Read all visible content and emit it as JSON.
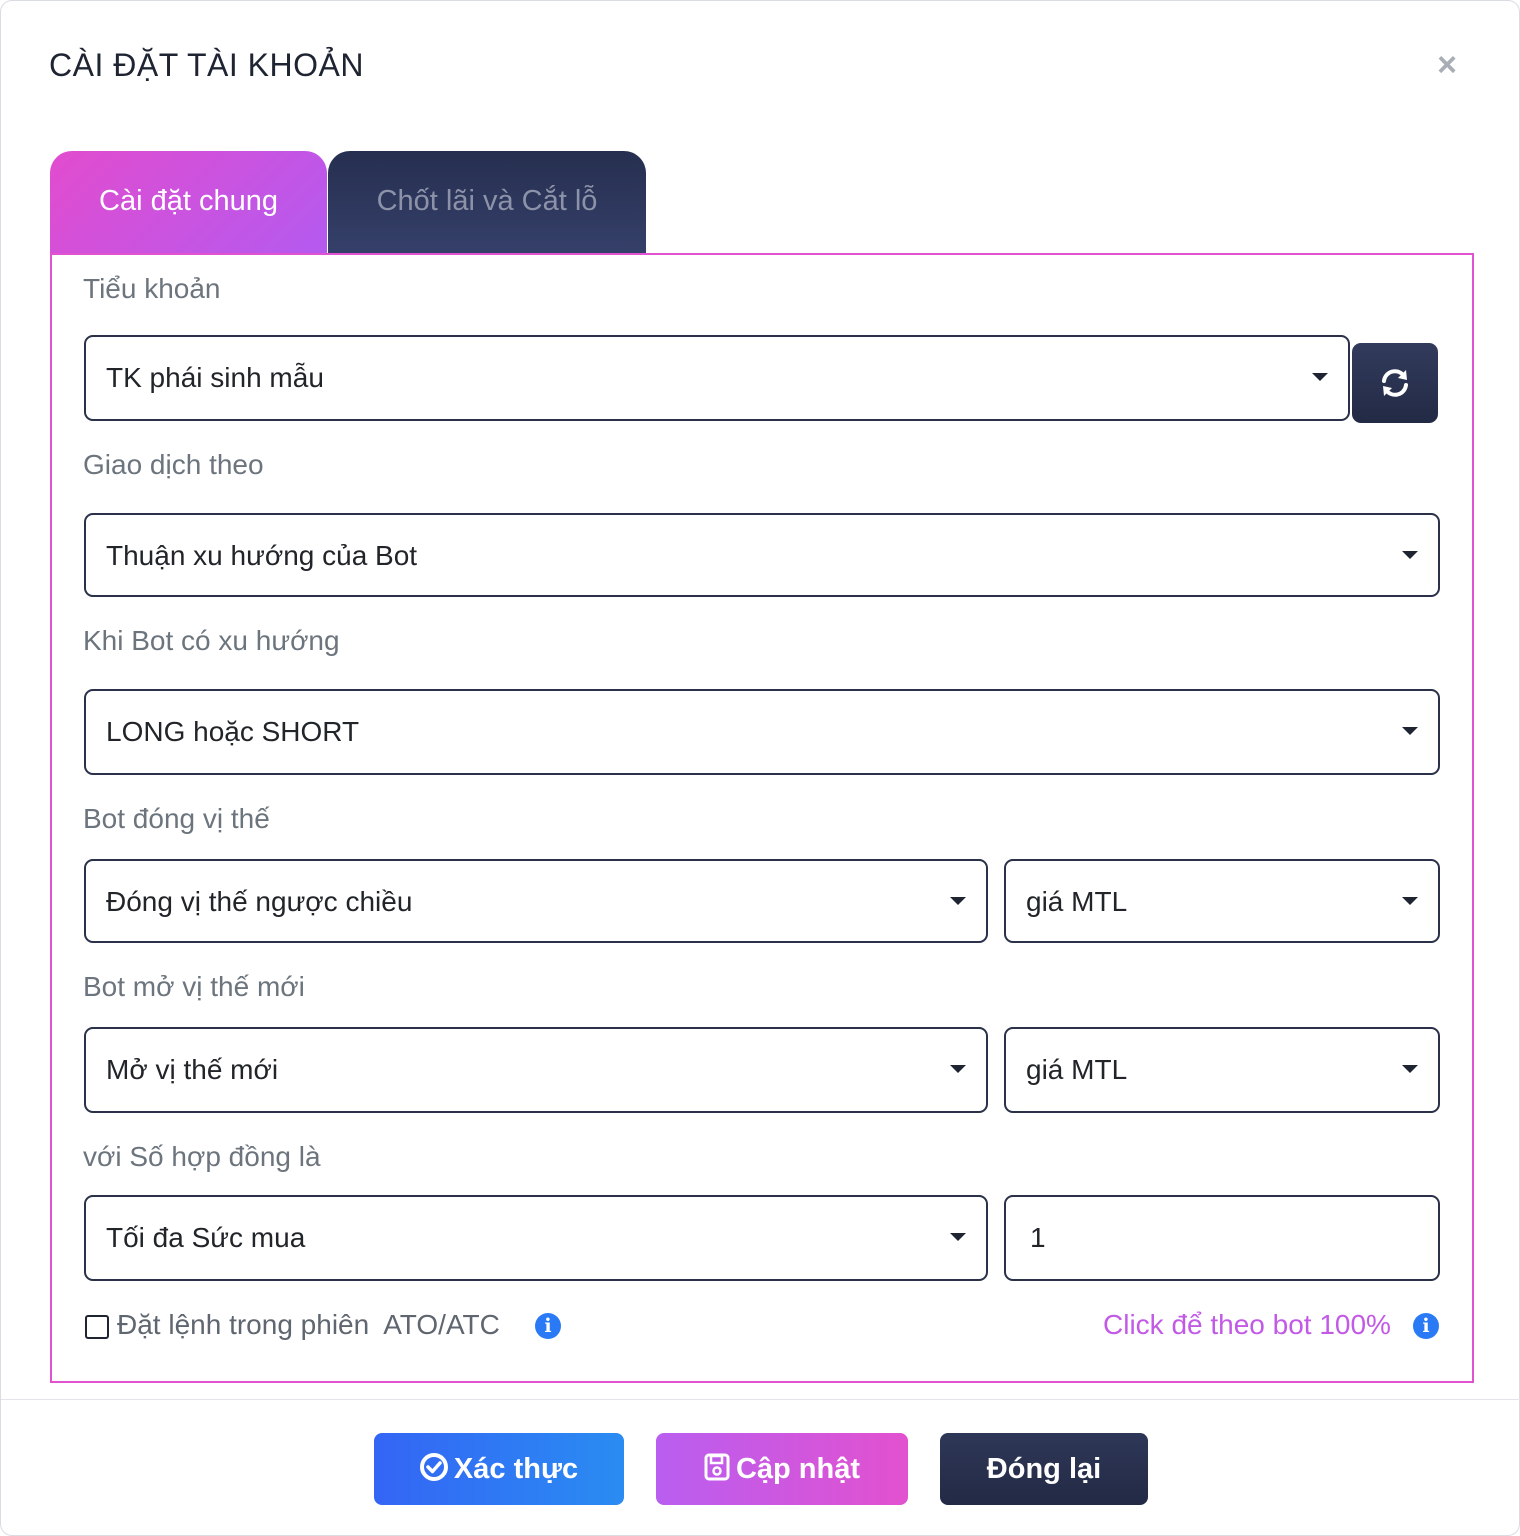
{
  "modal": {
    "title": "CÀI ĐẶT TÀI KHOẢN",
    "close_symbol": "×"
  },
  "tabs": [
    {
      "label": "Cài đặt chung",
      "active": true
    },
    {
      "label": "Chốt lãi và Cắt lỗ",
      "active": false
    }
  ],
  "form": {
    "sub_account": {
      "label": "Tiểu khoản",
      "value": "TK phái sinh mẫu",
      "refresh_icon": "refresh-icon"
    },
    "trade_by": {
      "label": "Giao dịch theo",
      "value": "Thuận xu hướng của Bot"
    },
    "when_trend": {
      "label": "Khi Bot có xu hướng",
      "value": "LONG hoặc SHORT"
    },
    "close_position": {
      "label": "Bot đóng vị thế",
      "value": "Đóng vị thế ngược chiều",
      "price": "giá MTL"
    },
    "open_position": {
      "label": "Bot mở vị thế mới",
      "value": "Mở vị thế mới",
      "price": "giá MTL"
    },
    "contracts": {
      "label": "với Số hợp đồng là",
      "value": "Tối đa Sức mua",
      "quantity": "1"
    },
    "session_order": {
      "label": "Đặt lệnh trong phiên  ATO/ATC",
      "checked": false
    },
    "follow_link": "Click để theo bot 100%"
  },
  "buttons": {
    "verify": "Xác thực",
    "update": "Cập nhật",
    "close": "Đóng lại"
  },
  "colors": {
    "accent_pink": "#e24cce",
    "accent_purple": "#b45af0",
    "navy": "#262f4f",
    "blue": "#3465f5",
    "info_blue": "#2a7af5"
  }
}
